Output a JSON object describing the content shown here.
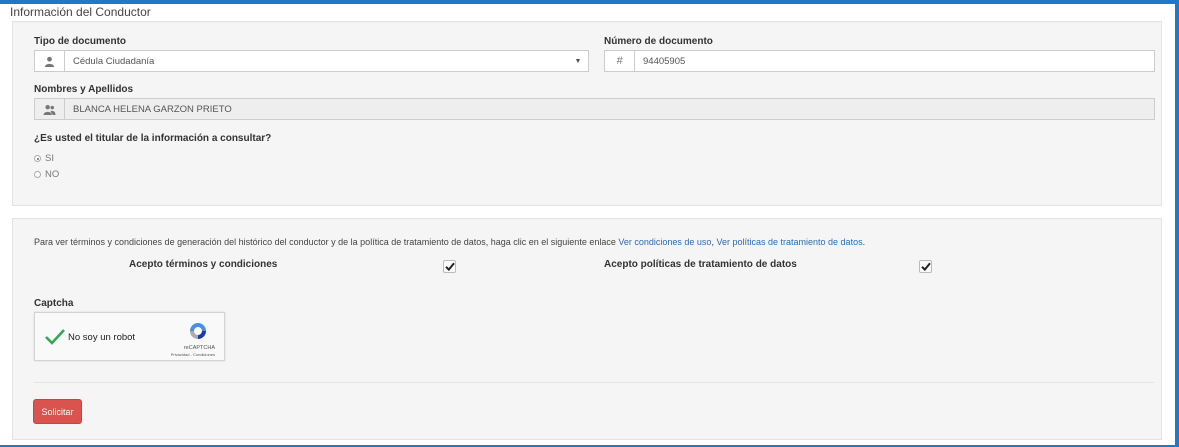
{
  "section": {
    "title": "Información del Conductor"
  },
  "doc_type": {
    "label": "Tipo de documento",
    "value": "Cédula Ciudadanía",
    "icon": "user-icon"
  },
  "doc_number": {
    "label": "Número de documento",
    "value": "94405905",
    "icon": "hash-icon"
  },
  "names": {
    "label": "Nombres y Apellidos",
    "value": "BLANCA HELENA GARZON PRIETO",
    "icon": "users-icon"
  },
  "holder": {
    "question": "¿Es usted el titular de la información a consultar?",
    "options": [
      {
        "label": "SI",
        "selected": true
      },
      {
        "label": "NO",
        "selected": false
      }
    ]
  },
  "terms": {
    "text": "Para ver términos y condiciones de generación del histórico del conductor y de la política de tratamiento de datos, haga clic en el siguiente enlace",
    "link_terms": "Ver condiciones de uso",
    "separator": ",",
    "link_policies": "Ver políticas de tratamiento de datos",
    "end": ".",
    "accept_terms_label": "Acepto términos y condiciones",
    "accept_terms_checked": true,
    "accept_policies_label": "Acepto políticas de tratamiento de datos",
    "accept_policies_checked": true
  },
  "captcha": {
    "label": "Captcha",
    "text": "No soy un robot",
    "brand": "reCAPTCHA",
    "links": "Privacidad - Condiciones"
  },
  "submit": {
    "label": "Solicitar",
    "color": "#d9534f"
  },
  "colors": {
    "frame": "#1f78c8",
    "link": "#2a6cb3",
    "check": "#34a853"
  }
}
